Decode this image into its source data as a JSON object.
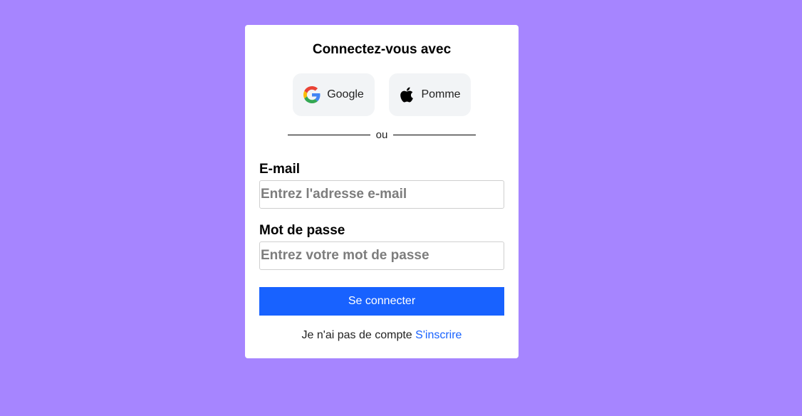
{
  "login": {
    "title": "Connectez-vous avec",
    "social": {
      "google_label": "Google",
      "apple_label": "Pomme"
    },
    "divider_text": "ou",
    "email": {
      "label": "E-mail",
      "placeholder": "Entrez l'adresse e-mail",
      "value": ""
    },
    "password": {
      "label": "Mot de passe",
      "placeholder": "Entrez votre mot de passe",
      "value": ""
    },
    "submit_label": "Se connecter",
    "signup_prompt": "Je n'ai pas de compte",
    "signup_link": "S'inscrire"
  },
  "icons": {
    "google": "google-logo-icon",
    "apple": "apple-logo-icon"
  },
  "colors": {
    "background": "#a685ff",
    "card": "#ffffff",
    "primary": "#1862ff",
    "social_button": "#f2f4f6"
  }
}
